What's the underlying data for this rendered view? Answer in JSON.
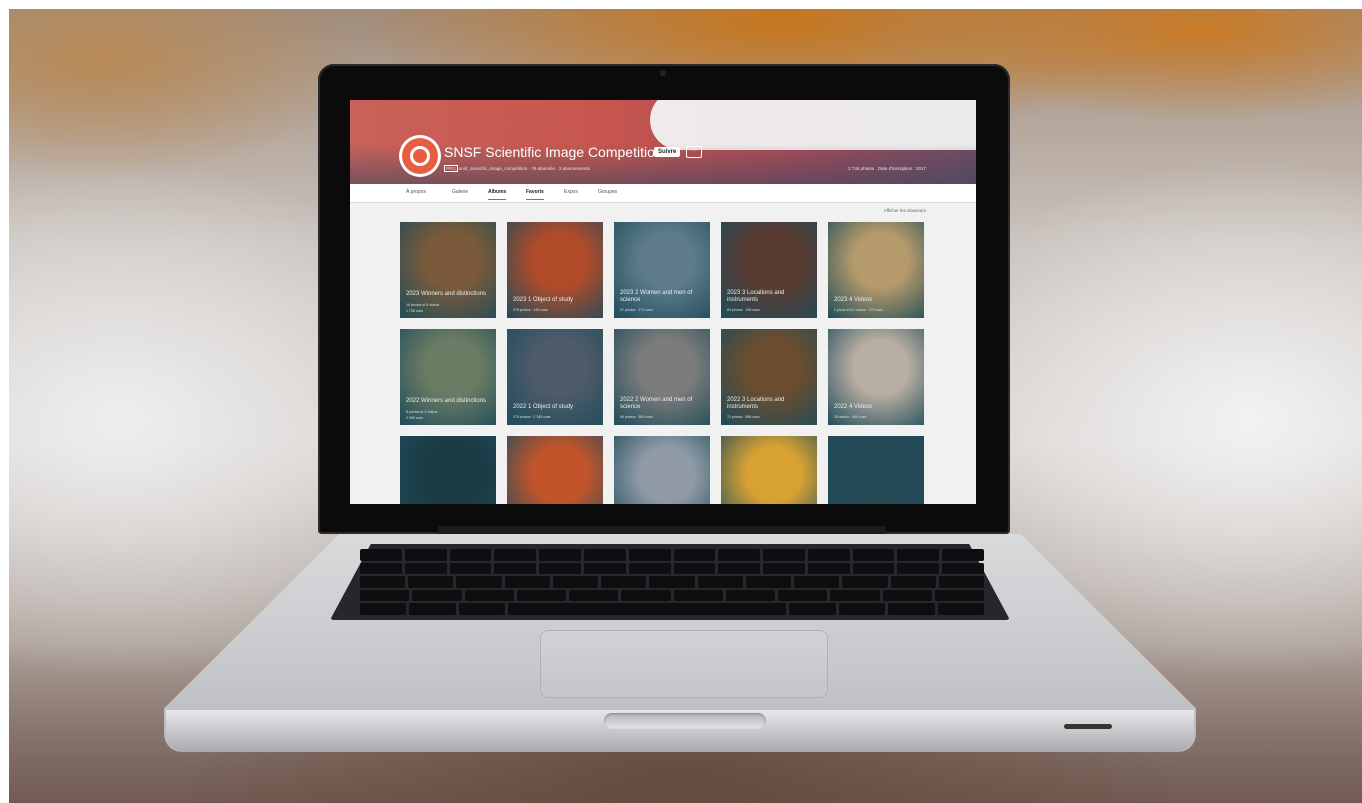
{
  "profile": {
    "name": "SNSF Scientific Image Competition",
    "follow_label": "Suivre",
    "more_label": "···",
    "pro_badge": "PRO",
    "username": "snsf_scientific_image_competition",
    "followers": "76 abonnés",
    "following": "2 abonnements",
    "photos_count": "2 746 photos",
    "joined": "Date d'inscription : 2017"
  },
  "nav": {
    "tabs": [
      "À propos",
      "Galerie",
      "Albums",
      "Favoris",
      "Expos",
      "Groupes"
    ],
    "active": "Albums"
  },
  "show_classifiers": "Afficher les classeurs",
  "albums": [
    {
      "title": "2023 Winners and distinctions",
      "meta": "16 photos et 5 vidéos",
      "views": "1 738 vues",
      "color": "#7a5a3a"
    },
    {
      "title": "2023 1 Object of study",
      "meta": "278 photos · 449 vues",
      "color": "#b04b2a"
    },
    {
      "title": "2023 2 Women and men of science",
      "meta": "97 photos · 272 vues",
      "color": "#5d7b8a"
    },
    {
      "title": "2023 3 Locations and instruments",
      "meta": "84 photos · 198 vues",
      "color": "#5a3b32"
    },
    {
      "title": "2023 4 Videos",
      "meta": "1 photo et 51 vidéos · 173 vues",
      "color": "#b59a6b"
    },
    {
      "title": "2022 Winners and distinctions",
      "meta": "8 photos et 3 vidéos",
      "views": "2 499 vues",
      "color": "#6b7c64"
    },
    {
      "title": "2022 1 Object of study",
      "meta": "178 photos · 2 349 vues",
      "color": "#4d5a6a"
    },
    {
      "title": "2022 2 Women and men of science",
      "meta": "46 photos · 859 vues",
      "color": "#7c7c7c"
    },
    {
      "title": "2022 3 Locations and instruments",
      "meta": "72 photos · 598 vues",
      "color": "#6b4d2f"
    },
    {
      "title": "2022 4 Videos",
      "meta": "28 vidéos · 469 vues",
      "color": "#b8aea3"
    },
    {
      "title": "",
      "meta": "",
      "color": "#1a3a44"
    },
    {
      "title": "",
      "meta": "",
      "color": "#c2542c"
    },
    {
      "title": "",
      "meta": "",
      "color": "#8f9aa6"
    },
    {
      "title": "",
      "meta": "",
      "color": "#d8a233"
    },
    {
      "title": "",
      "meta": "",
      "color": "#244a55"
    }
  ]
}
